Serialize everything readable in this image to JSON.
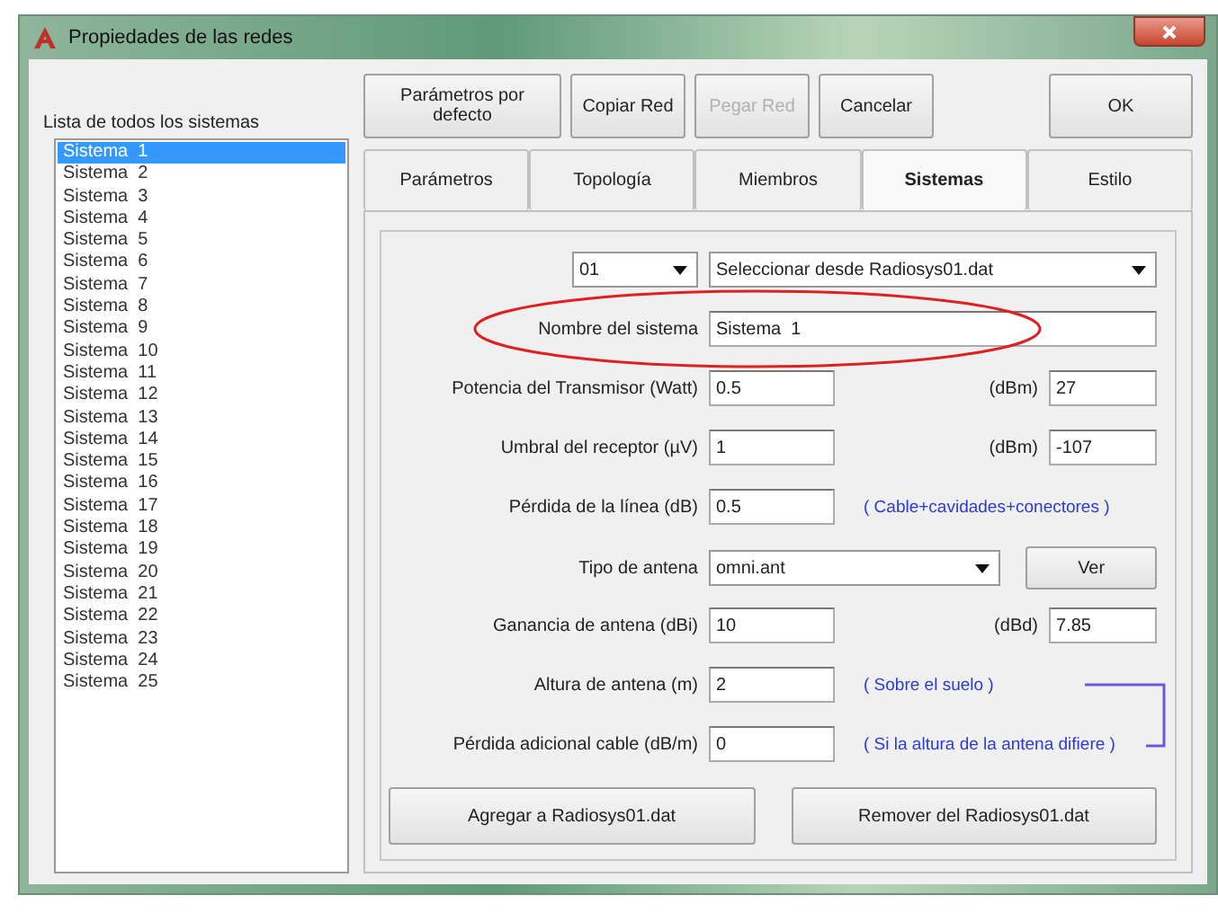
{
  "window": {
    "title": "Propiedades de las redes"
  },
  "list_label": "Lista de todos los sistemas",
  "systems": [
    {
      "label": "Sistema  1",
      "selected": true
    },
    {
      "label": "Sistema  2",
      "selected": false
    },
    {
      "label": "Sistema  3",
      "selected": false
    },
    {
      "label": "Sistema  4",
      "selected": false
    },
    {
      "label": "Sistema  5",
      "selected": false
    },
    {
      "label": "Sistema  6",
      "selected": false
    },
    {
      "label": "Sistema  7",
      "selected": false
    },
    {
      "label": "Sistema  8",
      "selected": false
    },
    {
      "label": "Sistema  9",
      "selected": false
    },
    {
      "label": "Sistema  10",
      "selected": false
    },
    {
      "label": "Sistema  11",
      "selected": false
    },
    {
      "label": "Sistema  12",
      "selected": false
    },
    {
      "label": "Sistema  13",
      "selected": false
    },
    {
      "label": "Sistema  14",
      "selected": false
    },
    {
      "label": "Sistema  15",
      "selected": false
    },
    {
      "label": "Sistema  16",
      "selected": false
    },
    {
      "label": "Sistema  17",
      "selected": false
    },
    {
      "label": "Sistema  18",
      "selected": false
    },
    {
      "label": "Sistema  19",
      "selected": false
    },
    {
      "label": "Sistema  20",
      "selected": false
    },
    {
      "label": "Sistema  21",
      "selected": false
    },
    {
      "label": "Sistema  22",
      "selected": false
    },
    {
      "label": "Sistema  23",
      "selected": false
    },
    {
      "label": "Sistema  24",
      "selected": false
    },
    {
      "label": "Sistema  25",
      "selected": false
    }
  ],
  "buttons": [
    {
      "label": "Parámetros por defecto",
      "disabled": false
    },
    {
      "label": "Copiar Red",
      "disabled": false
    },
    {
      "label": "Pegar Red",
      "disabled": true
    },
    {
      "label": "Cancelar",
      "disabled": false
    },
    {
      "label": "OK",
      "disabled": false
    }
  ],
  "tabs": [
    {
      "label": "Parámetros",
      "selected": false
    },
    {
      "label": "Topología",
      "selected": false
    },
    {
      "label": "Miembros",
      "selected": false
    },
    {
      "label": "Sistemas",
      "selected": true
    },
    {
      "label": "Estilo",
      "selected": false
    }
  ],
  "system_number": {
    "value": "01"
  },
  "source_select": {
    "value": "Seleccionar desde Radiosys01.dat"
  },
  "rows": [
    {
      "kind": "name",
      "label": "Nombre del sistema",
      "value": "Sistema  1",
      "highlighted": true
    },
    {
      "kind": "field",
      "label": "Potencia del Transmisor (Watt)",
      "value": "0.5",
      "unit": "(dBm)",
      "unit_value": "27"
    },
    {
      "kind": "field",
      "label": "Umbral del receptor (µV)",
      "value": "1",
      "unit": "(dBm)",
      "unit_value": "-107"
    },
    {
      "kind": "field",
      "label": "Pérdida de la línea (dB)",
      "value": "0.5",
      "note": "( Cable+cavidades+conectores )"
    },
    {
      "kind": "combo",
      "label": "Tipo de antena",
      "value": "omni.ant",
      "button": "Ver"
    },
    {
      "kind": "field",
      "label": "Ganancia de antena (dBi)",
      "value": "10",
      "unit": "(dBd)",
      "unit_value": "7.85"
    },
    {
      "kind": "field",
      "label": "Altura de antena (m)",
      "value": "2",
      "note": "( Sobre el suelo )"
    },
    {
      "kind": "field",
      "label": "Pérdida adicional cable (dB/m)",
      "value": "0",
      "note": "( Si la altura de la antena difiere )"
    }
  ],
  "actions": [
    "Agregar a Radiosys01.dat",
    "Remover del Radiosys01.dat"
  ]
}
